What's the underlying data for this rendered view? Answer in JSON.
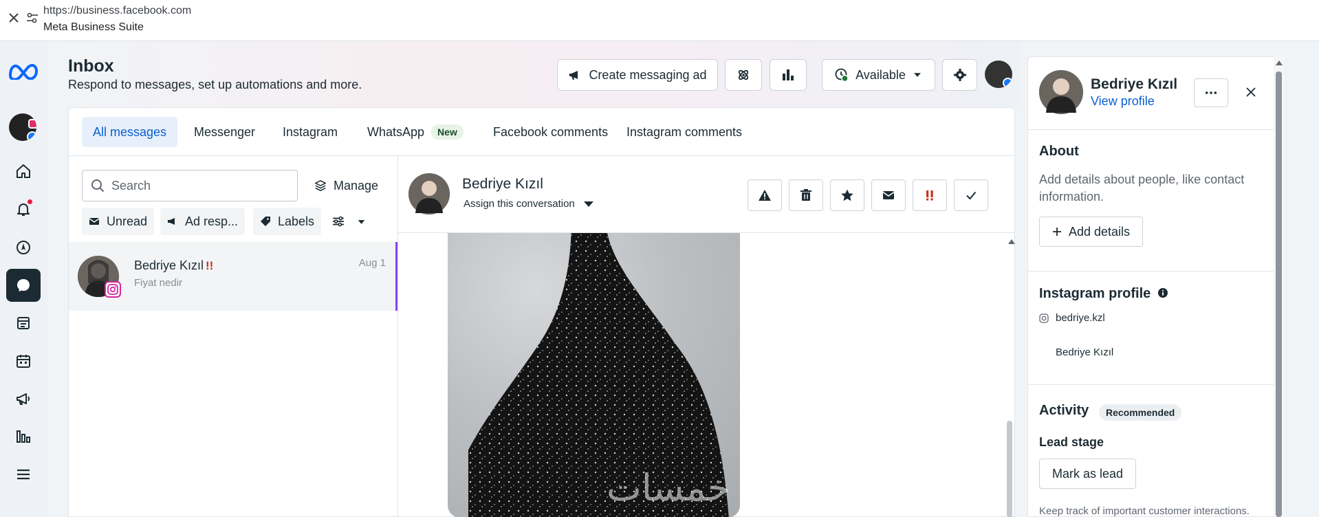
{
  "browser": {
    "url": "https://business.facebook.com",
    "app_title": "Meta Business Suite"
  },
  "nav": {
    "items": [
      "home-icon",
      "bell-icon",
      "compass-icon",
      "inbox-icon",
      "content-icon",
      "calendar-icon",
      "megaphone-icon",
      "insights-icon",
      "menu-icon"
    ],
    "active": "inbox-icon"
  },
  "header": {
    "title": "Inbox",
    "subtitle": "Respond to messages, set up automations and more.",
    "create_ad_label": "Create messaging ad",
    "status_label": "Available"
  },
  "tabs": [
    {
      "label": "All messages",
      "active": true
    },
    {
      "label": "Messenger"
    },
    {
      "label": "Instagram"
    },
    {
      "label": "WhatsApp",
      "badge": "New"
    },
    {
      "label": "Facebook comments"
    },
    {
      "label": "Instagram comments"
    }
  ],
  "list": {
    "search_placeholder": "Search",
    "manage_label": "Manage",
    "filters": [
      "Unread",
      "Ad resp...",
      "Labels"
    ],
    "conversations": [
      {
        "name": "Bedriye Kızıl",
        "flag": "!!",
        "preview": "Fiyat nedir",
        "date": "Aug 1",
        "platform": "instagram"
      }
    ]
  },
  "chat": {
    "name": "Bedriye Kızıl",
    "assign_label": "Assign this conversation",
    "watermark": "خمسات"
  },
  "profile": {
    "name": "Bedriye Kızıl",
    "view_profile": "View profile",
    "about_title": "About",
    "about_desc": "Add details about people, like contact information.",
    "add_details": "Add details",
    "ig_title": "Instagram profile",
    "ig_handle": "bedriye.kzl",
    "ig_name": "Bedriye Kızıl",
    "activity_title": "Activity",
    "activity_badge": "Recommended",
    "lead_stage_title": "Lead stage",
    "mark_lead": "Mark as lead",
    "footer_text": "Keep track of important customer interactions."
  },
  "colors": {
    "accent": "#0a5fd0",
    "active_tab_bg": "#e6effa",
    "nav_active": "#1c2b33",
    "selected_border": "#8a3ffc"
  }
}
